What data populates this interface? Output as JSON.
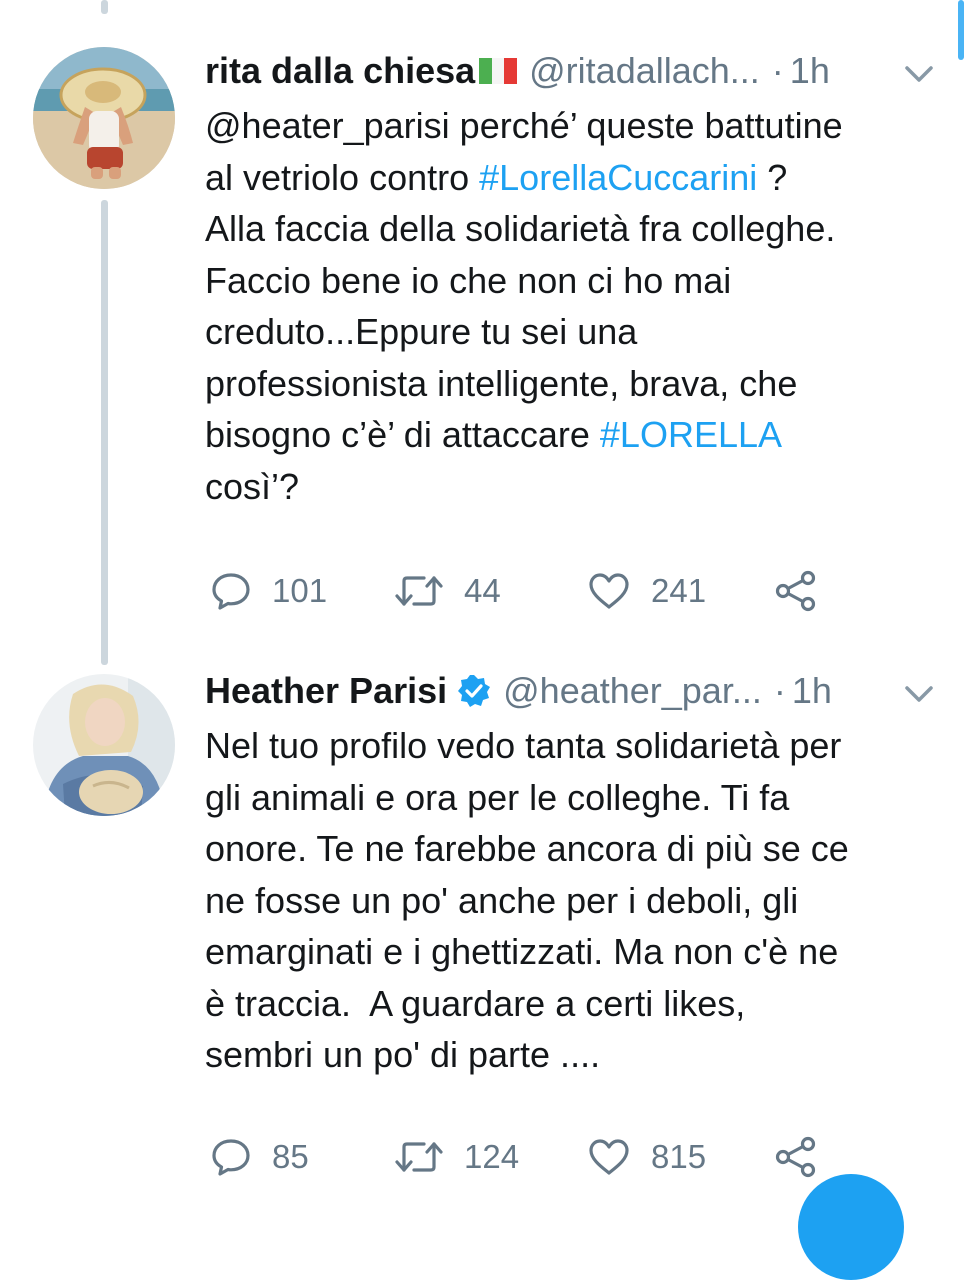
{
  "tweets": [
    {
      "name": "rita dalla chiesa",
      "handle": "@ritadallach...",
      "separator": "·",
      "time": "1h",
      "body": [
        {
          "t": "@heater_parisi perché’ queste battutine",
          "h": false
        },
        {
          "t": "al vetriolo contro ",
          "h": false
        },
        {
          "t": "#LorellaCuccarini",
          "h": true
        },
        {
          "t": " ?",
          "h": false
        },
        {
          "t": "Alla faccia della solidarietà fra colleghe.",
          "h": false
        },
        {
          "t": "Faccio bene io che non ci ho mai",
          "h": false
        },
        {
          "t": "creduto...Eppure tu sei una",
          "h": false
        },
        {
          "t": "professionista intelligente, brava, che",
          "h": false
        },
        {
          "t": "bisogno c’è’ di attaccare ",
          "h": false
        },
        {
          "t": "#LORELLA",
          "h": true
        },
        {
          "t": "così’?",
          "h": false
        }
      ],
      "replies": "101",
      "retweets": "44",
      "likes": "241"
    },
    {
      "name": "Heather Parisi",
      "handle": "@heather_par...",
      "separator": "·",
      "time": "1h",
      "lines": [
        "Nel tuo profilo vedo tanta solidarietà per",
        "gli animali e ora per le colleghe. Ti fa",
        "onore. Te ne farebbe ancora di più se ce",
        "ne fosse un po' anche per i deboli, gli",
        "emarginati e i ghettizzati. Ma non c'è ne",
        "è traccia.  A guardare a certi likes,",
        "sembri un po' di parte ...."
      ],
      "replies": "85",
      "retweets": "124",
      "likes": "815"
    }
  ],
  "icons": {
    "reply": "reply-icon",
    "retweet": "retweet-icon",
    "like": "heart-icon",
    "share": "share-icon",
    "menu": "chevron-down-icon",
    "verified": "verified-badge-icon",
    "flag": "italy-flag-icon"
  },
  "colors": {
    "link": "#1da1f2",
    "secondary": "#657786",
    "text": "#14171a",
    "thread": "#ccd6dd",
    "verified": "#1da1f2"
  }
}
